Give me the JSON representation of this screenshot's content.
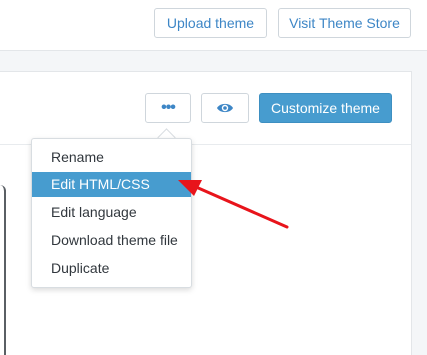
{
  "header": {
    "upload_label": "Upload theme",
    "store_label": "Visit Theme Store"
  },
  "theme_card": {
    "more_icon": "ellipsis-icon",
    "more_glyph": "•••",
    "preview_icon": "eye-icon",
    "customize_label": "Customize theme"
  },
  "actions_menu": {
    "items": [
      {
        "label": "Rename"
      },
      {
        "label": "Edit HTML/CSS"
      },
      {
        "label": "Edit language"
      },
      {
        "label": "Download theme file"
      },
      {
        "label": "Duplicate"
      }
    ],
    "highlighted_item": "Edit HTML/CSS"
  },
  "annotation": {
    "arrow_color": "#e8141b",
    "points_to": "Edit HTML/CSS"
  },
  "colors": {
    "accent": "#479ccf",
    "link": "#3d86c6",
    "background": "#f4f6f8"
  }
}
